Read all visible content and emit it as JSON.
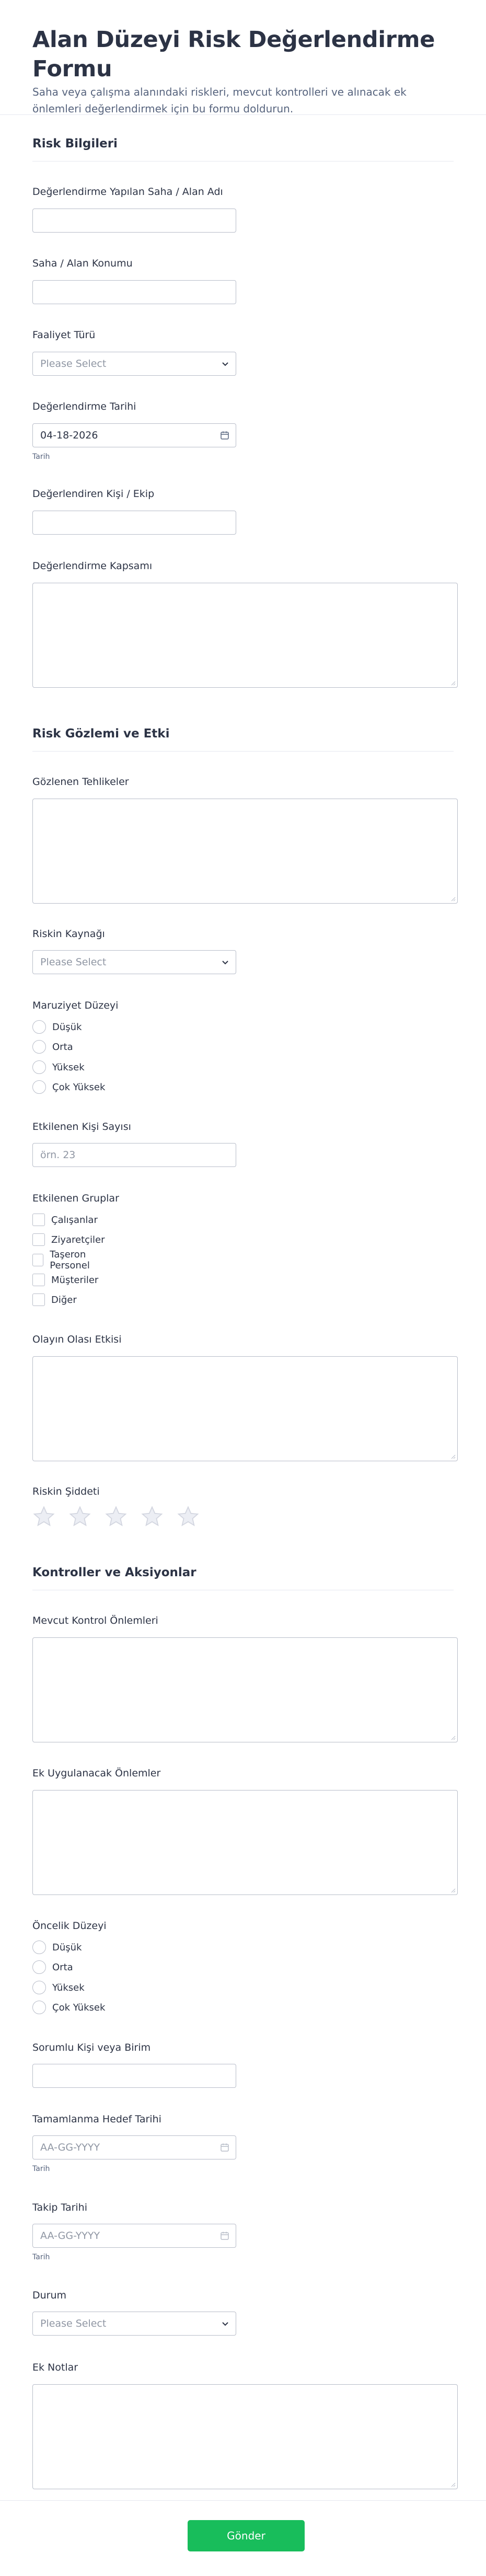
{
  "header": {
    "title": "Alan Düzeyi Risk Değerlendirme Formu",
    "subtitle": "Saha veya çalışma alanındaki riskleri, mevcut kontrolleri ve alınacak ek önlemleri değerlendirmek için bu formu doldurun."
  },
  "sections": {
    "risk_info": "Risk Bilgileri",
    "observation": "Risk Gözlemi ve Etki",
    "controls": "Kontroller ve Aksiyonlar"
  },
  "fields": {
    "site_name": {
      "label": "Değerlendirme Yapılan Saha / Alan Adı",
      "value": ""
    },
    "site_location": {
      "label": "Saha / Alan Konumu",
      "value": ""
    },
    "activity_type": {
      "label": "Faaliyet Türü",
      "placeholder": "Please Select"
    },
    "assessment_date": {
      "label": "Değerlendirme Tarihi",
      "value": "04-18-2026",
      "sublabel": "Tarih"
    },
    "assessor": {
      "label": "Değerlendiren Kişi / Ekip",
      "value": ""
    },
    "scope": {
      "label": "Değerlendirme Kapsamı"
    },
    "hazards": {
      "label": "Gözlenen Tehlikeler"
    },
    "risk_source": {
      "label": "Riskin Kaynağı",
      "placeholder": "Please Select"
    },
    "exposure": {
      "label": "Maruziyet Düzeyi",
      "options": [
        "Düşük",
        "Orta",
        "Yüksek",
        "Çok Yüksek"
      ]
    },
    "affected_count": {
      "label": "Etkilenen Kişi Sayısı",
      "placeholder": "örn. 23"
    },
    "affected_groups": {
      "label": "Etkilenen Gruplar",
      "options": [
        "Çalışanlar",
        "Ziyaretçiler",
        "Taşeron Personel",
        "Müşteriler",
        "Diğer"
      ]
    },
    "impact": {
      "label": "Olayın Olası Etkisi"
    },
    "severity": {
      "label": "Riskin Şiddeti",
      "rating": 0,
      "max": 5
    },
    "current_controls": {
      "label": "Mevcut Kontrol Önlemleri"
    },
    "extra_measures": {
      "label": "Ek Uygulanacak Önlemler"
    },
    "priority": {
      "label": "Öncelik Düzeyi",
      "options": [
        "Düşük",
        "Orta",
        "Yüksek",
        "Çok Yüksek"
      ]
    },
    "responsible": {
      "label": "Sorumlu Kişi veya Birim",
      "value": ""
    },
    "target_date": {
      "label": "Tamamlanma Hedef Tarihi",
      "placeholder": "AA-GG-YYYY",
      "sublabel": "Tarih"
    },
    "followup_date": {
      "label": "Takip Tarihi",
      "placeholder": "AA-GG-YYYY",
      "sublabel": "Tarih"
    },
    "status": {
      "label": "Durum",
      "placeholder": "Please Select"
    },
    "notes": {
      "label": "Ek Notlar"
    }
  },
  "submit_label": "Gönder",
  "colors": {
    "accent": "#18bd5b",
    "border": "#b8bdc9",
    "text": "#2c3345",
    "star": "#d3d6e0"
  }
}
